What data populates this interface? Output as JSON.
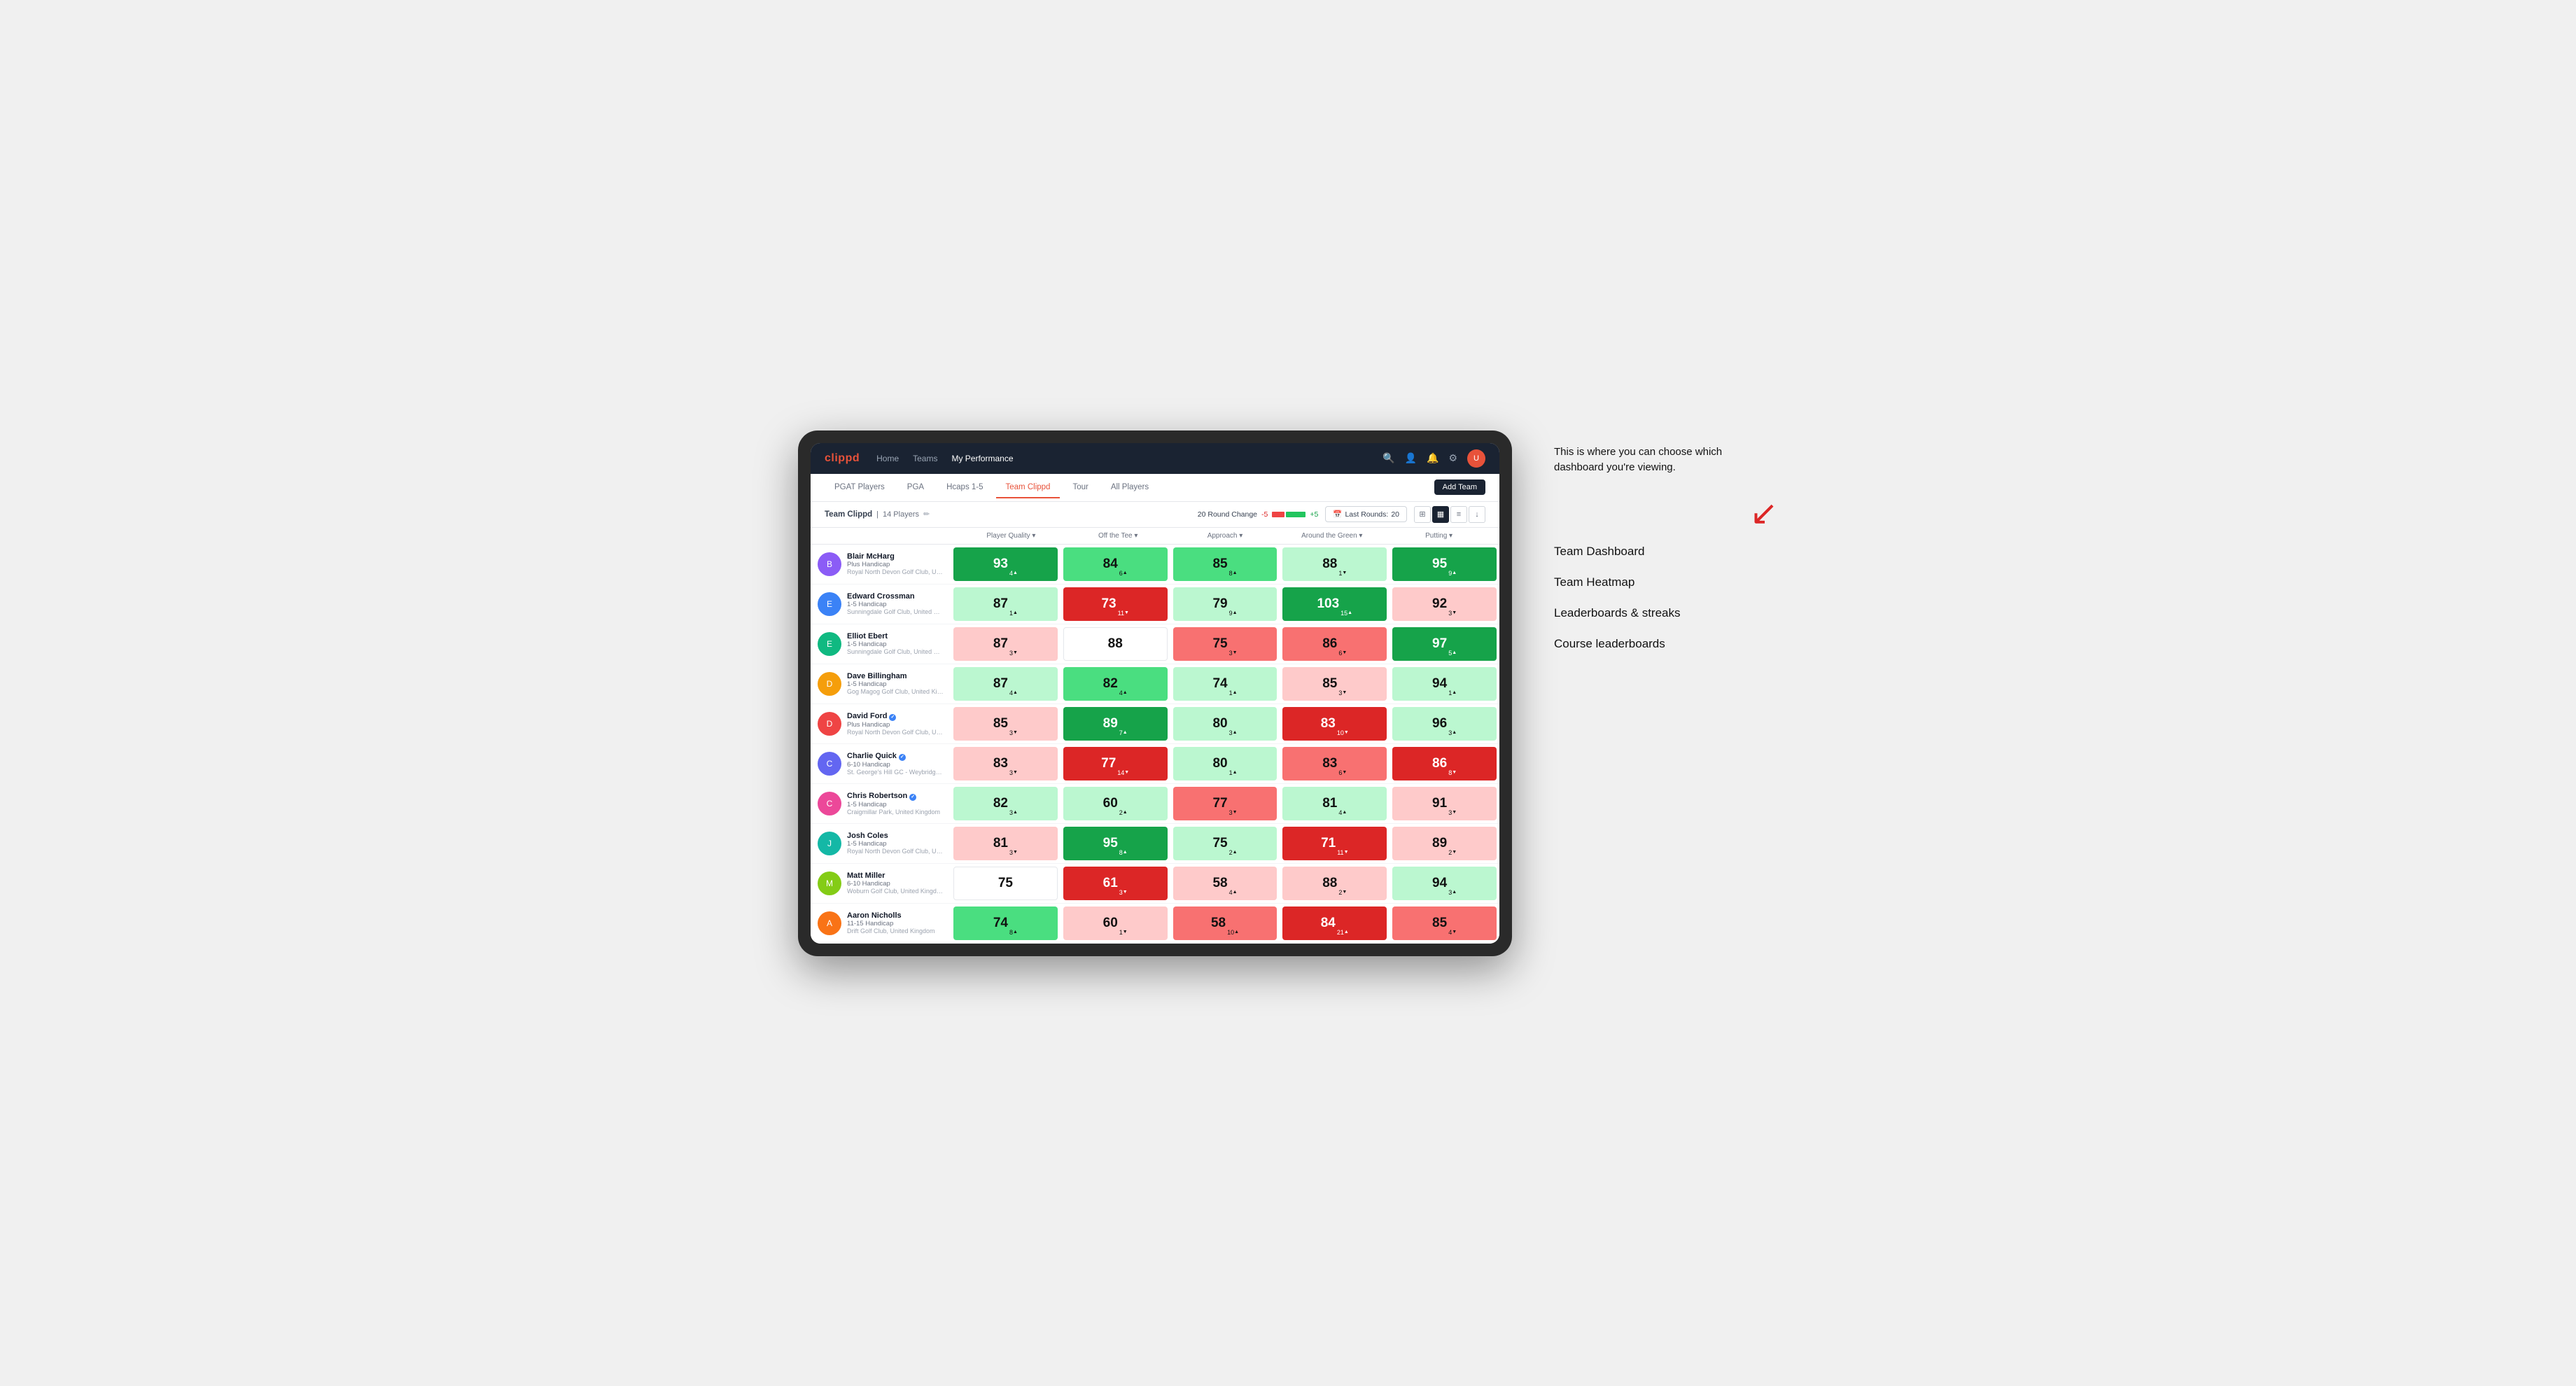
{
  "annotation": {
    "intro": "This is where you can choose which dashboard you're viewing.",
    "options": [
      "Team Dashboard",
      "Team Heatmap",
      "Leaderboards & streaks",
      "Course leaderboards"
    ]
  },
  "nav": {
    "logo": "clippd",
    "links": [
      "Home",
      "Teams",
      "My Performance"
    ],
    "active_link": "My Performance"
  },
  "tabs": {
    "items": [
      "PGAT Players",
      "PGA",
      "Hcaps 1-5",
      "Team Clippd",
      "Tour",
      "All Players"
    ],
    "active": "Team Clippd",
    "add_button": "Add Team"
  },
  "toolbar": {
    "team_name": "Team Clippd",
    "player_count": "14 Players",
    "round_change_label": "20 Round Change",
    "change_neg": "-5",
    "change_pos": "+5",
    "last_rounds_label": "Last Rounds:",
    "last_rounds_value": "20"
  },
  "table": {
    "headers": [
      "Player Quality ▾",
      "Off the Tee ▾",
      "Approach ▾",
      "Around the Green ▾",
      "Putting ▾"
    ],
    "players": [
      {
        "name": "Blair McHarg",
        "handicap": "Plus Handicap",
        "club": "Royal North Devon Golf Club, United Kingdom",
        "scores": [
          {
            "value": "93",
            "change": "4",
            "dir": "up",
            "color": "green-dark"
          },
          {
            "value": "84",
            "change": "6",
            "dir": "up",
            "color": "green-mid"
          },
          {
            "value": "85",
            "change": "8",
            "dir": "up",
            "color": "green-mid"
          },
          {
            "value": "88",
            "change": "1",
            "dir": "down",
            "color": "green-light"
          },
          {
            "value": "95",
            "change": "9",
            "dir": "up",
            "color": "green-dark"
          }
        ]
      },
      {
        "name": "Edward Crossman",
        "handicap": "1-5 Handicap",
        "club": "Sunningdale Golf Club, United Kingdom",
        "scores": [
          {
            "value": "87",
            "change": "1",
            "dir": "up",
            "color": "green-light"
          },
          {
            "value": "73",
            "change": "11",
            "dir": "down",
            "color": "red-dark"
          },
          {
            "value": "79",
            "change": "9",
            "dir": "up",
            "color": "green-light"
          },
          {
            "value": "103",
            "change": "15",
            "dir": "up",
            "color": "green-dark"
          },
          {
            "value": "92",
            "change": "3",
            "dir": "down",
            "color": "red-light"
          }
        ]
      },
      {
        "name": "Elliot Ebert",
        "handicap": "1-5 Handicap",
        "club": "Sunningdale Golf Club, United Kingdom",
        "scores": [
          {
            "value": "87",
            "change": "3",
            "dir": "down",
            "color": "red-light"
          },
          {
            "value": "88",
            "change": "",
            "dir": "",
            "color": "neutral"
          },
          {
            "value": "75",
            "change": "3",
            "dir": "down",
            "color": "red-mid"
          },
          {
            "value": "86",
            "change": "6",
            "dir": "down",
            "color": "red-mid"
          },
          {
            "value": "97",
            "change": "5",
            "dir": "up",
            "color": "green-dark"
          }
        ]
      },
      {
        "name": "Dave Billingham",
        "handicap": "1-5 Handicap",
        "club": "Gog Magog Golf Club, United Kingdom",
        "scores": [
          {
            "value": "87",
            "change": "4",
            "dir": "up",
            "color": "green-light"
          },
          {
            "value": "82",
            "change": "4",
            "dir": "up",
            "color": "green-mid"
          },
          {
            "value": "74",
            "change": "1",
            "dir": "up",
            "color": "green-light"
          },
          {
            "value": "85",
            "change": "3",
            "dir": "down",
            "color": "red-light"
          },
          {
            "value": "94",
            "change": "1",
            "dir": "up",
            "color": "green-light"
          }
        ]
      },
      {
        "name": "David Ford",
        "handicap": "Plus Handicap",
        "club": "Royal North Devon Golf Club, United Kingdom",
        "verified": true,
        "scores": [
          {
            "value": "85",
            "change": "3",
            "dir": "down",
            "color": "red-light"
          },
          {
            "value": "89",
            "change": "7",
            "dir": "up",
            "color": "green-dark"
          },
          {
            "value": "80",
            "change": "3",
            "dir": "up",
            "color": "green-light"
          },
          {
            "value": "83",
            "change": "10",
            "dir": "down",
            "color": "red-dark"
          },
          {
            "value": "96",
            "change": "3",
            "dir": "up",
            "color": "green-light"
          }
        ]
      },
      {
        "name": "Charlie Quick",
        "handicap": "6-10 Handicap",
        "club": "St. George's Hill GC - Weybridge, Surrey, Uni...",
        "verified": true,
        "scores": [
          {
            "value": "83",
            "change": "3",
            "dir": "down",
            "color": "red-light"
          },
          {
            "value": "77",
            "change": "14",
            "dir": "down",
            "color": "red-dark"
          },
          {
            "value": "80",
            "change": "1",
            "dir": "up",
            "color": "green-light"
          },
          {
            "value": "83",
            "change": "6",
            "dir": "down",
            "color": "red-mid"
          },
          {
            "value": "86",
            "change": "8",
            "dir": "down",
            "color": "red-dark"
          }
        ]
      },
      {
        "name": "Chris Robertson",
        "handicap": "1-5 Handicap",
        "club": "Craigmillar Park, United Kingdom",
        "verified": true,
        "scores": [
          {
            "value": "82",
            "change": "3",
            "dir": "up",
            "color": "green-light"
          },
          {
            "value": "60",
            "change": "2",
            "dir": "up",
            "color": "green-light"
          },
          {
            "value": "77",
            "change": "3",
            "dir": "down",
            "color": "red-mid"
          },
          {
            "value": "81",
            "change": "4",
            "dir": "up",
            "color": "green-light"
          },
          {
            "value": "91",
            "change": "3",
            "dir": "down",
            "color": "red-light"
          }
        ]
      },
      {
        "name": "Josh Coles",
        "handicap": "1-5 Handicap",
        "club": "Royal North Devon Golf Club, United Kingdom",
        "scores": [
          {
            "value": "81",
            "change": "3",
            "dir": "down",
            "color": "red-light"
          },
          {
            "value": "95",
            "change": "8",
            "dir": "up",
            "color": "green-dark"
          },
          {
            "value": "75",
            "change": "2",
            "dir": "up",
            "color": "green-light"
          },
          {
            "value": "71",
            "change": "11",
            "dir": "down",
            "color": "red-dark"
          },
          {
            "value": "89",
            "change": "2",
            "dir": "down",
            "color": "red-light"
          }
        ]
      },
      {
        "name": "Matt Miller",
        "handicap": "6-10 Handicap",
        "club": "Woburn Golf Club, United Kingdom",
        "scores": [
          {
            "value": "75",
            "change": "",
            "dir": "",
            "color": "neutral"
          },
          {
            "value": "61",
            "change": "3",
            "dir": "down",
            "color": "red-dark"
          },
          {
            "value": "58",
            "change": "4",
            "dir": "up",
            "color": "red-light"
          },
          {
            "value": "88",
            "change": "2",
            "dir": "down",
            "color": "red-light"
          },
          {
            "value": "94",
            "change": "3",
            "dir": "up",
            "color": "green-light"
          }
        ]
      },
      {
        "name": "Aaron Nicholls",
        "handicap": "11-15 Handicap",
        "club": "Drift Golf Club, United Kingdom",
        "scores": [
          {
            "value": "74",
            "change": "8",
            "dir": "up",
            "color": "green-mid"
          },
          {
            "value": "60",
            "change": "1",
            "dir": "down",
            "color": "red-light"
          },
          {
            "value": "58",
            "change": "10",
            "dir": "up",
            "color": "red-mid"
          },
          {
            "value": "84",
            "change": "21",
            "dir": "up",
            "color": "red-dark"
          },
          {
            "value": "85",
            "change": "4",
            "dir": "down",
            "color": "red-mid"
          }
        ]
      }
    ]
  }
}
